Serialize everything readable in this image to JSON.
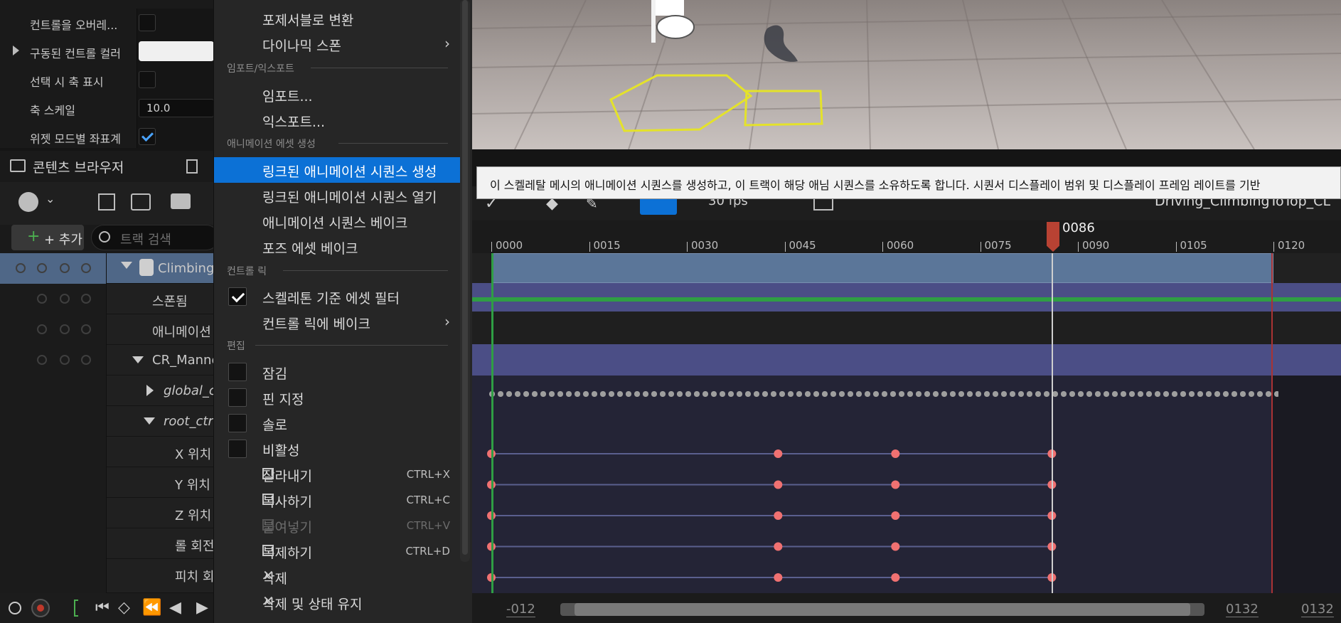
{
  "details": {
    "rows": [
      {
        "label": "컨트롤을 오버레...",
        "type": "checkbox",
        "checked": false
      },
      {
        "label": "구동된 컨트롤 컬러",
        "type": "color",
        "expandable": true
      },
      {
        "label": "선택 시 축 표시",
        "type": "checkbox",
        "checked": false
      },
      {
        "label": "축 스케일",
        "type": "number",
        "value": "10.0"
      },
      {
        "label": "위젯 모드별 좌표계",
        "type": "checkbox",
        "checked": true
      }
    ]
  },
  "content_browser": {
    "tab_label": "콘텐츠 브라우저",
    "add_label": "+ 추가",
    "search_placeholder": "트랙 검색"
  },
  "tracks": [
    {
      "label": "Climbing",
      "indent": 0,
      "expanded": true,
      "selected": true
    },
    {
      "label": "스폰됨",
      "indent": 1
    },
    {
      "label": "애니메이션",
      "indent": 1
    },
    {
      "label": "CR_Manne",
      "indent": 1,
      "expanded": true
    },
    {
      "label": "global_c",
      "indent": 2,
      "italic": true,
      "collapsed": true
    },
    {
      "label": "root_ctr",
      "indent": 2,
      "italic": true,
      "expanded": true
    },
    {
      "label": "X 위치",
      "indent": 3
    },
    {
      "label": "Y 위치",
      "indent": 3
    },
    {
      "label": "Z 위치",
      "indent": 3
    },
    {
      "label": "롤 회전",
      "indent": 3
    },
    {
      "label": "피치 회",
      "indent": 3
    }
  ],
  "menu": {
    "items": [
      {
        "type": "item",
        "label": "포제서블로 변환"
      },
      {
        "type": "item",
        "label": "다이나믹 스폰",
        "submenu": true
      },
      {
        "type": "section",
        "label": "임포트/익스포트"
      },
      {
        "type": "item",
        "label": "임포트..."
      },
      {
        "type": "item",
        "label": "익스포트..."
      },
      {
        "type": "section",
        "label": "애니메이션 에셋 생성"
      },
      {
        "type": "item",
        "label": "링크된 애니메이션 시퀀스 생성",
        "highlighted": true
      },
      {
        "type": "item",
        "label": "링크된 애니메이션 시퀀스 열기"
      },
      {
        "type": "item",
        "label": "애니메이션 시퀀스 베이크"
      },
      {
        "type": "item",
        "label": "포즈 에셋 베이크"
      },
      {
        "type": "section",
        "label": "컨트롤 릭"
      },
      {
        "type": "check",
        "label": "스켈레톤 기준 에셋 필터",
        "checked": true
      },
      {
        "type": "item",
        "label": "컨트롤 릭에 베이크",
        "submenu": true
      },
      {
        "type": "section",
        "label": "편집"
      },
      {
        "type": "check",
        "label": "잠김",
        "checked": false
      },
      {
        "type": "check",
        "label": "핀 지정",
        "checked": false
      },
      {
        "type": "check",
        "label": "솔로",
        "checked": false
      },
      {
        "type": "check",
        "label": "비활성",
        "checked": false
      },
      {
        "type": "icon",
        "label": "잘라내기",
        "shortcut": "CTRL+X",
        "icon": "cut-icon"
      },
      {
        "type": "icon",
        "label": "복사하기",
        "shortcut": "CTRL+C",
        "icon": "copy-icon"
      },
      {
        "type": "icon",
        "label": "붙여넣기",
        "shortcut": "CTRL+V",
        "icon": "paste-icon",
        "disabled": true
      },
      {
        "type": "icon",
        "label": "복제하기",
        "shortcut": "CTRL+D",
        "icon": "duplicate-icon"
      },
      {
        "type": "icon",
        "label": "삭제",
        "icon": "delete-icon"
      },
      {
        "type": "icon",
        "label": "삭제 및 상태 유지",
        "icon": "delete-icon"
      }
    ]
  },
  "tooltip": "이 스켈레탈 메시의 애니메이션 시퀀스를 생성하고, 이 트랙이 해당 애님 시퀀스를 소유하도록 합니다. 시퀀서 디스플레이 범위 및 디스플레이 프레임 레이트를 기반",
  "sequencer": {
    "fps_label": "30 fps",
    "sequence_name": "Driving_ClimbingToTop_CL",
    "current_frame": "0086",
    "ruler_labels": [
      "0000",
      "0015",
      "0030",
      "0045",
      "0060",
      "0075",
      "0090",
      "0105",
      "0120"
    ],
    "range_start": "-012",
    "range_end": "0132",
    "range_end_2": "0132",
    "keys_frames": [
      0,
      44,
      62,
      86
    ],
    "key_rows": 5,
    "colors": {
      "selection": "#0c71d6",
      "playhead": "#c0392b",
      "key": "#f07171",
      "section_blue": "#5b7699",
      "section_purple": "#4b4e86",
      "green_line": "#2f9e44"
    }
  }
}
